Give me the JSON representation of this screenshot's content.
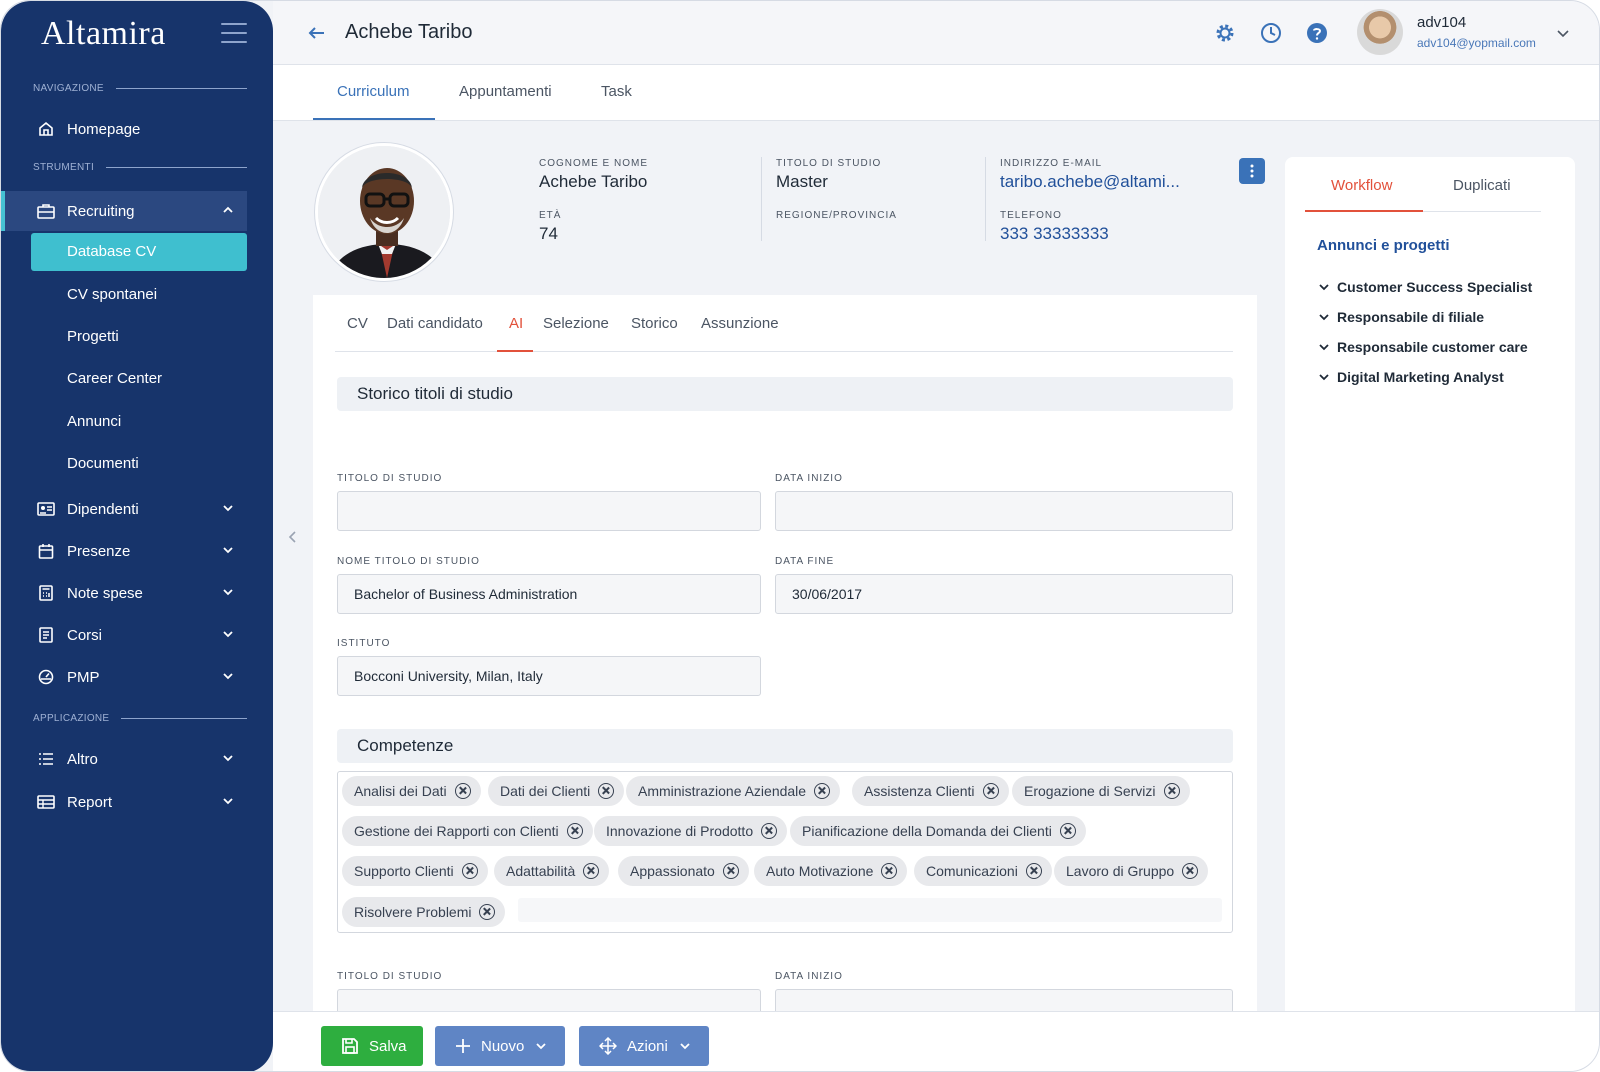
{
  "app": {
    "logo": "Altamira"
  },
  "sidebar": {
    "sections": {
      "navigazione": "NAVIGAZIONE",
      "strumenti": "STRUMENTI",
      "applicazione": "APPLICAZIONE"
    },
    "homepage": "Homepage",
    "recruiting": "Recruiting",
    "recruiting_sub": [
      "Database CV",
      "CV spontanei",
      "Progetti",
      "Career Center",
      "Annunci",
      "Documenti"
    ],
    "tools": [
      "Dipendenti",
      "Presenze",
      "Note spese",
      "Corsi",
      "PMP"
    ],
    "apps": [
      "Altro",
      "Report"
    ]
  },
  "header": {
    "title": "Achebe Taribo",
    "user_name": "adv104",
    "user_email": "adv104@yopmail.com"
  },
  "main_tabs": [
    "Curriculum",
    "Appuntamenti",
    "Task"
  ],
  "profile": {
    "name_label": "COGNOME E NOME",
    "name": "Achebe Taribo",
    "age_label": "ETÀ",
    "age": "74",
    "title_label": "TITOLO DI STUDIO",
    "title": "Master",
    "region_label": "REGIONE/PROVINCIA",
    "email_label": "INDIRIZZO E-MAIL",
    "email": "taribo.achebe@altami...",
    "phone_label": "TELEFONO",
    "phone": "333 33333333"
  },
  "sub_tabs": [
    "CV",
    "Dati candidato",
    "AI",
    "Selezione",
    "Storico",
    "Assunzione"
  ],
  "education": {
    "section_title": "Storico titoli di studio",
    "titolo_label": "TITOLO DI STUDIO",
    "titolo_value": "",
    "data_inizio_label": "DATA INIZIO",
    "data_inizio_value": "",
    "nome_titolo_label": "NOME TITOLO DI STUDIO",
    "nome_titolo_value": "Bachelor of Business Administration",
    "data_fine_label": "DATA FINE",
    "data_fine_value": "30/06/2017",
    "istituto_label": "ISTITUTO",
    "istituto_value": "Bocconi University, Milan, Italy",
    "titolo2_label": "TITOLO DI STUDIO",
    "data_inizio2_label": "DATA INIZIO"
  },
  "skills": {
    "section_title": "Competenze",
    "chips": [
      "Analisi dei Dati",
      "Dati dei Clienti",
      "Amministrazione Aziendale",
      "Assistenza Clienti",
      "Erogazione di Servizi",
      "Gestione dei Rapporti con Clienti",
      "Innovazione di Prodotto",
      "Pianificazione della Domanda dei Clienti",
      "Supporto Clienti",
      "Adattabilità",
      "Appassionato",
      "Auto Motivazione",
      "Comunicazioni",
      "Lavoro di Gruppo",
      "Risolvere Problemi"
    ]
  },
  "right_panel": {
    "tabs": [
      "Workflow",
      "Duplicati"
    ],
    "heading": "Annunci e progetti",
    "items": [
      "Customer Success Specialist",
      "Responsabile di filiale",
      "Responsabile customer care",
      "Digital Marketing Analyst"
    ]
  },
  "actions": {
    "save": "Salva",
    "new": "Nuovo",
    "actions": "Azioni"
  },
  "colors": {
    "sidebar": "#17346b",
    "accent_teal": "#3fbfcf",
    "accent_red": "#e2513b",
    "link_blue": "#21509a",
    "save_green": "#2eae3f"
  }
}
